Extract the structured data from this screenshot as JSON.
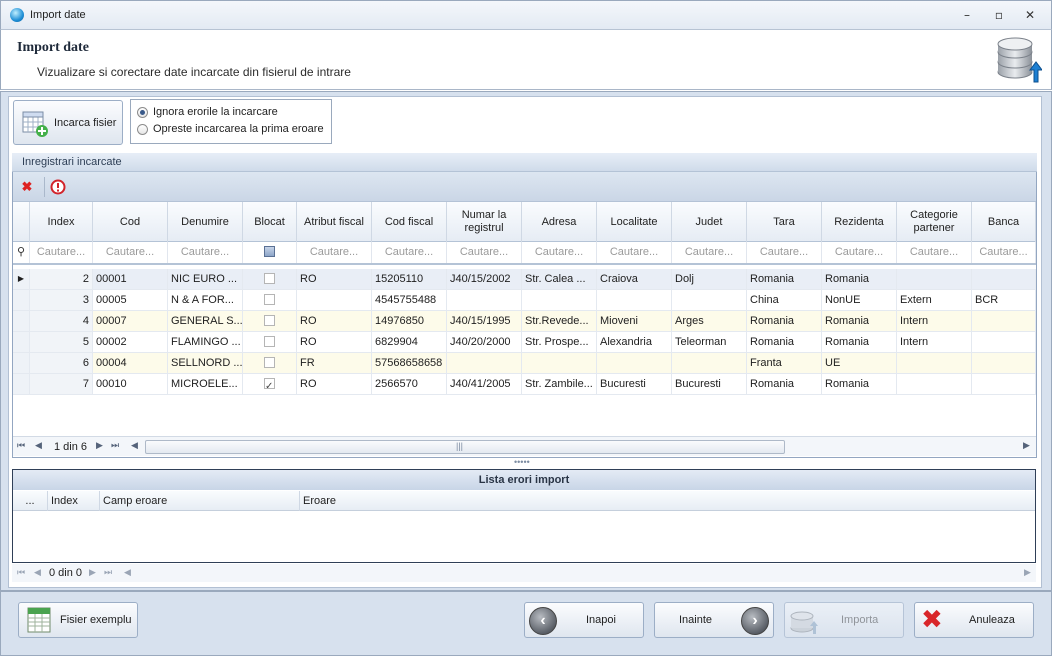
{
  "window": {
    "title": "Import date"
  },
  "header": {
    "title": "Import date",
    "subtitle": "Vizualizare si corectare date incarcate din fisierul de intrare"
  },
  "toolbar": {
    "load_label": "Incarca fisier",
    "options": [
      {
        "label": "Ignora erorile la incarcare",
        "selected": true
      },
      {
        "label": "Opreste incarcarea la prima eroare",
        "selected": false
      }
    ]
  },
  "loaded": {
    "caption": "Inregistrari incarcate",
    "columns": [
      "Index",
      "Cod",
      "Denumire",
      "Blocat",
      "Atribut fiscal",
      "Cod fiscal",
      "Numar la registrul",
      "Adresa",
      "Localitate",
      "Judet",
      "Tara",
      "Rezidenta",
      "Categorie partener",
      "Banca"
    ],
    "filter_placeholder": "Cautare...",
    "rows": [
      {
        "index": "2",
        "cod": "00001",
        "denumire": "NIC EURO ...",
        "blocat": false,
        "atribut": "RO",
        "cod_fiscal": "15205110",
        "registru": "J40/15/2002",
        "adresa": "Str. Calea ...",
        "localitate": "Craiova",
        "judet": "Dolj",
        "tara": "Romania",
        "rezidenta": "Romania",
        "categorie": "",
        "banca": ""
      },
      {
        "index": "3",
        "cod": "00005",
        "denumire": "N & A FOR...",
        "blocat": false,
        "atribut": "",
        "cod_fiscal": "4545755488",
        "registru": "",
        "adresa": "",
        "localitate": "",
        "judet": "",
        "tara": "China",
        "rezidenta": "NonUE",
        "categorie": "Extern",
        "banca": "BCR"
      },
      {
        "index": "4",
        "cod": "00007",
        "denumire": "GENERAL S...",
        "blocat": false,
        "atribut": "RO",
        "cod_fiscal": "14976850",
        "registru": "J40/15/1995",
        "adresa": "Str.Revede...",
        "localitate": "Mioveni",
        "judet": "Arges",
        "tara": "Romania",
        "rezidenta": "Romania",
        "categorie": "Intern",
        "banca": ""
      },
      {
        "index": "5",
        "cod": "00002",
        "denumire": "FLAMINGO ...",
        "blocat": false,
        "atribut": "RO",
        "cod_fiscal": "6829904",
        "registru": "J40/20/2000",
        "adresa": "Str. Prospe...",
        "localitate": "Alexandria",
        "judet": "Teleorman",
        "tara": "Romania",
        "rezidenta": "Romania",
        "categorie": "Intern",
        "banca": ""
      },
      {
        "index": "6",
        "cod": "00004",
        "denumire": "SELLNORD ...",
        "blocat": false,
        "atribut": "FR",
        "cod_fiscal": "57568658658",
        "registru": "",
        "adresa": "",
        "localitate": "",
        "judet": "",
        "tara": "Franta",
        "rezidenta": "UE",
        "categorie": "",
        "banca": ""
      },
      {
        "index": "7",
        "cod": "00010",
        "denumire": "MICROELE...",
        "blocat": true,
        "atribut": "RO",
        "cod_fiscal": "2566570",
        "registru": "J40/41/2005",
        "adresa": "Str. Zambile...",
        "localitate": "Bucuresti",
        "judet": "Bucuresti",
        "tara": "Romania",
        "rezidenta": "Romania",
        "categorie": "",
        "banca": ""
      }
    ],
    "pager": "1 din 6"
  },
  "errors": {
    "caption": "Lista erori import",
    "columns": [
      "...",
      "Index",
      "Camp eroare",
      "Eroare"
    ],
    "pager": "0 din 0"
  },
  "footer": {
    "sample_label": "Fisier exemplu",
    "back_label": "Inapoi",
    "next_label": "Inainte",
    "import_label": "Importa",
    "cancel_label": "Anuleaza"
  }
}
